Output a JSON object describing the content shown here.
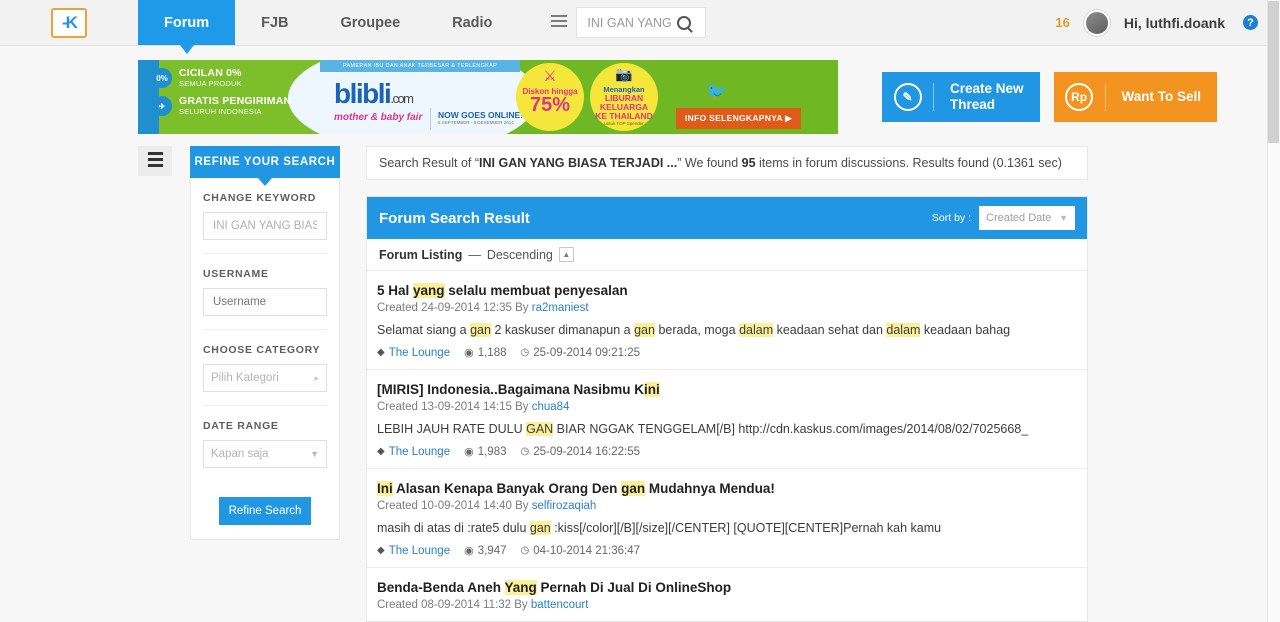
{
  "header": {
    "logo_text": "-K",
    "nav": [
      {
        "label": "Forum",
        "active": true
      },
      {
        "label": "FJB",
        "active": false
      },
      {
        "label": "Groupee",
        "active": false
      },
      {
        "label": "Radio",
        "active": false
      }
    ],
    "list_icon": "list-icon",
    "search": {
      "value": "INI GAN YANG B",
      "placeholder": "Search",
      "icon": "search-icon"
    },
    "notification_count": "16",
    "greeting": "Hi, luthfi.doank",
    "help_icon": "?"
  },
  "banner": {
    "features": [
      {
        "badge": "0%",
        "title": "CICILAN 0%",
        "subtitle": "SEMUA PRODUK"
      },
      {
        "badge": "✈",
        "title": "GRATIS PENGIRIMAN",
        "subtitle": "SELURUH INDONESIA"
      }
    ],
    "top_strip": "PAMERAN IBU DAN ANAK TERBESAR & TERLENGKAP",
    "logo": "blibli",
    "logo_suffix": ".com",
    "fair_text": "mother & baby fair",
    "now_online": "NOW GOES ONLINE!",
    "now_online_dates": "8 SEPTEMBER - 8 DESEMBER 2014",
    "discount_label": "Diskon hingga",
    "discount_value": "75%",
    "prize_line1": "Menangkan",
    "prize_line2": "LIBURAN KELUARGA",
    "prize_line3": "KE THAILAND",
    "prize_line4": "untuk TOP Spender",
    "cta": "INFO SELENGKAPNYA ▶"
  },
  "actions": {
    "create_thread": {
      "label_line1": "Create New",
      "label_line2": "Thread",
      "icon": "pencil-icon"
    },
    "want_to_sell": {
      "label": "Want To Sell",
      "icon": "rupiah-icon"
    }
  },
  "sidebar": {
    "toggle_icon": "list-toggle-icon",
    "header": "REFINE YOUR SEARCH",
    "fields": [
      {
        "label": "CHANGE KEYWORD",
        "value": "INI GAN YANG BIASA",
        "type": "text"
      },
      {
        "label": "USERNAME",
        "value": "Username",
        "type": "text"
      },
      {
        "label": "CHOOSE CATEGORY",
        "value": "Pilih Kategori",
        "type": "chevron"
      },
      {
        "label": "DATE RANGE",
        "value": "Kapan saja",
        "type": "dropdown"
      }
    ],
    "refine_button": "Refine Search"
  },
  "results_note": {
    "prefix": "Search Result of “",
    "query": "INI GAN YANG BIASA TERJADI ...",
    "middle": "” We found ",
    "count": "95",
    "suffix": " items in forum discussions. Results found (0.1361 sec)"
  },
  "panel": {
    "title": "Forum Search Result",
    "sort_label": "Sort by :",
    "sort_value": "Created Date",
    "listing_label": "Forum Listing",
    "listing_sep": " — ",
    "listing_order": "Descending",
    "sort_toggle_icon": "chevron-up-icon"
  },
  "results": [
    {
      "title_parts": [
        {
          "t": "5 Hal ",
          "hl": false
        },
        {
          "t": "yang",
          "hl": true
        },
        {
          "t": " selalu membuat penyesalan",
          "hl": false
        }
      ],
      "created_prefix": "Created ",
      "created": "24-09-2014 12:35",
      "by_label": " By ",
      "author": "ra2maniest",
      "snippet_parts": [
        {
          "t": "Selamat siang a ",
          "hl": false
        },
        {
          "t": "gan",
          "hl": true
        },
        {
          "t": " 2 kaskuser dimanapun a ",
          "hl": false
        },
        {
          "t": "gan",
          "hl": true
        },
        {
          "t": " berada, moga ",
          "hl": false
        },
        {
          "t": "dalam",
          "hl": true
        },
        {
          "t": " keadaan sehat dan ",
          "hl": false
        },
        {
          "t": "dalam",
          "hl": true
        },
        {
          "t": " keadaan bahag",
          "hl": false
        }
      ],
      "category": "The Lounge",
      "views": "1,188",
      "timestamp": "25-09-2014 09:21:25"
    },
    {
      "title_parts": [
        {
          "t": "[MIRIS] Indonesia..Bagaimana Nasibmu K",
          "hl": false
        },
        {
          "t": "ini",
          "hl": true
        }
      ],
      "created_prefix": "Created ",
      "created": "13-09-2014 14:15",
      "by_label": " By ",
      "author": "chua84",
      "snippet_parts": [
        {
          "t": "LEBIH JAUH RATE DULU ",
          "hl": false
        },
        {
          "t": "GAN",
          "hl": true
        },
        {
          "t": " BIAR NGGAK TENGGELAM[/B] http://cdn.kaskus.com/images/2014/08/02/7025668_",
          "hl": false
        }
      ],
      "category": "The Lounge",
      "views": "1,983",
      "timestamp": "25-09-2014 16:22:55"
    },
    {
      "title_parts": [
        {
          "t": "Ini",
          "hl": true
        },
        {
          "t": " Alasan Kenapa Banyak Orang Den ",
          "hl": false
        },
        {
          "t": "gan",
          "hl": true
        },
        {
          "t": " Mudahnya Mendua!",
          "hl": false
        }
      ],
      "created_prefix": "Created ",
      "created": "10-09-2014 14:40",
      "by_label": " By ",
      "author": "selfirozaqiah",
      "snippet_parts": [
        {
          "t": "masih di atas di :rate5 dulu ",
          "hl": false
        },
        {
          "t": "gan",
          "hl": true
        },
        {
          "t": " :kiss[/color][/B][/size][/CENTER] [QUOTE][CENTER]Pernah kah kamu",
          "hl": false
        }
      ],
      "category": "The Lounge",
      "views": "3,947",
      "timestamp": "04-10-2014 21:36:47"
    },
    {
      "title_parts": [
        {
          "t": "Benda-Benda Aneh ",
          "hl": false
        },
        {
          "t": "Yang",
          "hl": true
        },
        {
          "t": " Pernah Di Jual Di OnlineShop",
          "hl": false
        }
      ],
      "created_prefix": "Created ",
      "created": "08-09-2014 11:32",
      "by_label": " By ",
      "author": "battencourt",
      "snippet_parts": [],
      "category": "",
      "views": "",
      "timestamp": ""
    }
  ],
  "icons": {
    "tag": "◆",
    "eye": "◉",
    "clock": "◷"
  }
}
